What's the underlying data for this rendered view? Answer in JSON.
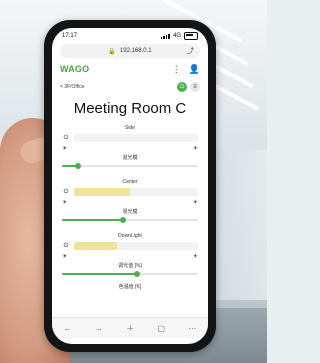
{
  "status": {
    "time": "17:17",
    "network": "4G"
  },
  "browser": {
    "url": "192.168.0.1",
    "share_icon": "share-icon",
    "lock_icon": "lock-icon"
  },
  "app": {
    "logo": "WAGO",
    "menu_icon": "more-icon",
    "user_icon": "user-icon"
  },
  "breadcrumb": "< 3F/Office",
  "room_title": "Meeting Room C",
  "sections": [
    {
      "name": "Side",
      "value": "",
      "buttons": [
        "☀",
        "☀"
      ],
      "mode": "混光模",
      "slider_percent": 12
    },
    {
      "name": "Center",
      "value": "",
      "buttons": [
        "☀",
        "☀"
      ],
      "mode": "混光模",
      "slider_percent": 45
    },
    {
      "name": "DownLight",
      "value": "",
      "buttons": [
        "☀",
        "☀"
      ],
      "mode": "调光值 [%]",
      "slider_percent": 55
    }
  ],
  "bottom_caption": "色温值 [K]",
  "colors": {
    "accent": "#4caf50",
    "logo": "#4aa33a",
    "value_fill": "#efe39a"
  }
}
